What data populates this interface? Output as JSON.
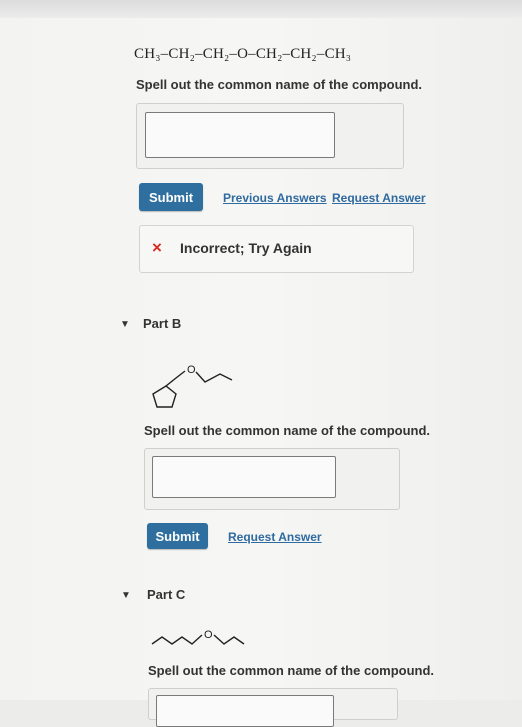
{
  "part_a": {
    "formula": "CH₃–CH₂–CH₂–O–CH₂–CH₂–CH₃",
    "prompt": "Spell out the common name of the compound.",
    "answer_value": "",
    "submit_label": "Submit",
    "previous_answers_label": "Previous Answers",
    "request_answer_label": "Request Answer",
    "feedback_icon": "×",
    "feedback_text": "Incorrect; Try Again"
  },
  "part_b": {
    "toggle": "▼",
    "title": "Part B",
    "oxygen_label": "O",
    "prompt": "Spell out the common name of the compound.",
    "answer_value": "",
    "submit_label": "Submit",
    "request_answer_label": "Request Answer"
  },
  "part_c": {
    "toggle": "▼",
    "title": "Part C",
    "oxygen_label": "O",
    "prompt": "Spell out the common name of the compound."
  },
  "colors": {
    "button": "#2f6f9f",
    "link": "#2f6aa0",
    "error": "#d52b1e"
  }
}
